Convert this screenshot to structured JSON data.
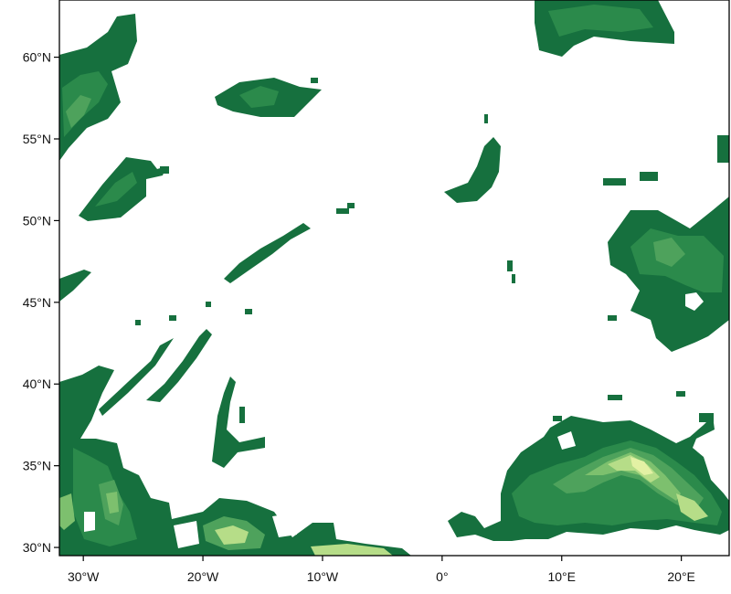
{
  "map": {
    "projection": "lat-lon (cylindrical)",
    "extent": {
      "lon": [
        -32,
        24
      ],
      "lat": [
        29.5,
        63.5
      ]
    },
    "background_color": "#ffffff",
    "frame_color": "#000000",
    "field_colors": [
      "#16703e",
      "#2b8a4b",
      "#4ea25c",
      "#7dc06e",
      "#b6dd88",
      "#e3f1a4"
    ],
    "lon_ticks": [
      {
        "value": -30,
        "label": "30°W"
      },
      {
        "value": -20,
        "label": "20°W"
      },
      {
        "value": -10,
        "label": "10°W"
      },
      {
        "value": 0,
        "label": "0°"
      },
      {
        "value": 10,
        "label": "10°E"
      },
      {
        "value": 20,
        "label": "20°E"
      }
    ],
    "lat_ticks": [
      {
        "value": 30,
        "label": "30°N"
      },
      {
        "value": 35,
        "label": "35°N"
      },
      {
        "value": 40,
        "label": "40°N"
      },
      {
        "value": 45,
        "label": "45°N"
      },
      {
        "value": 50,
        "label": "50°N"
      },
      {
        "value": 55,
        "label": "55°N"
      },
      {
        "value": 60,
        "label": "60°N"
      }
    ]
  }
}
